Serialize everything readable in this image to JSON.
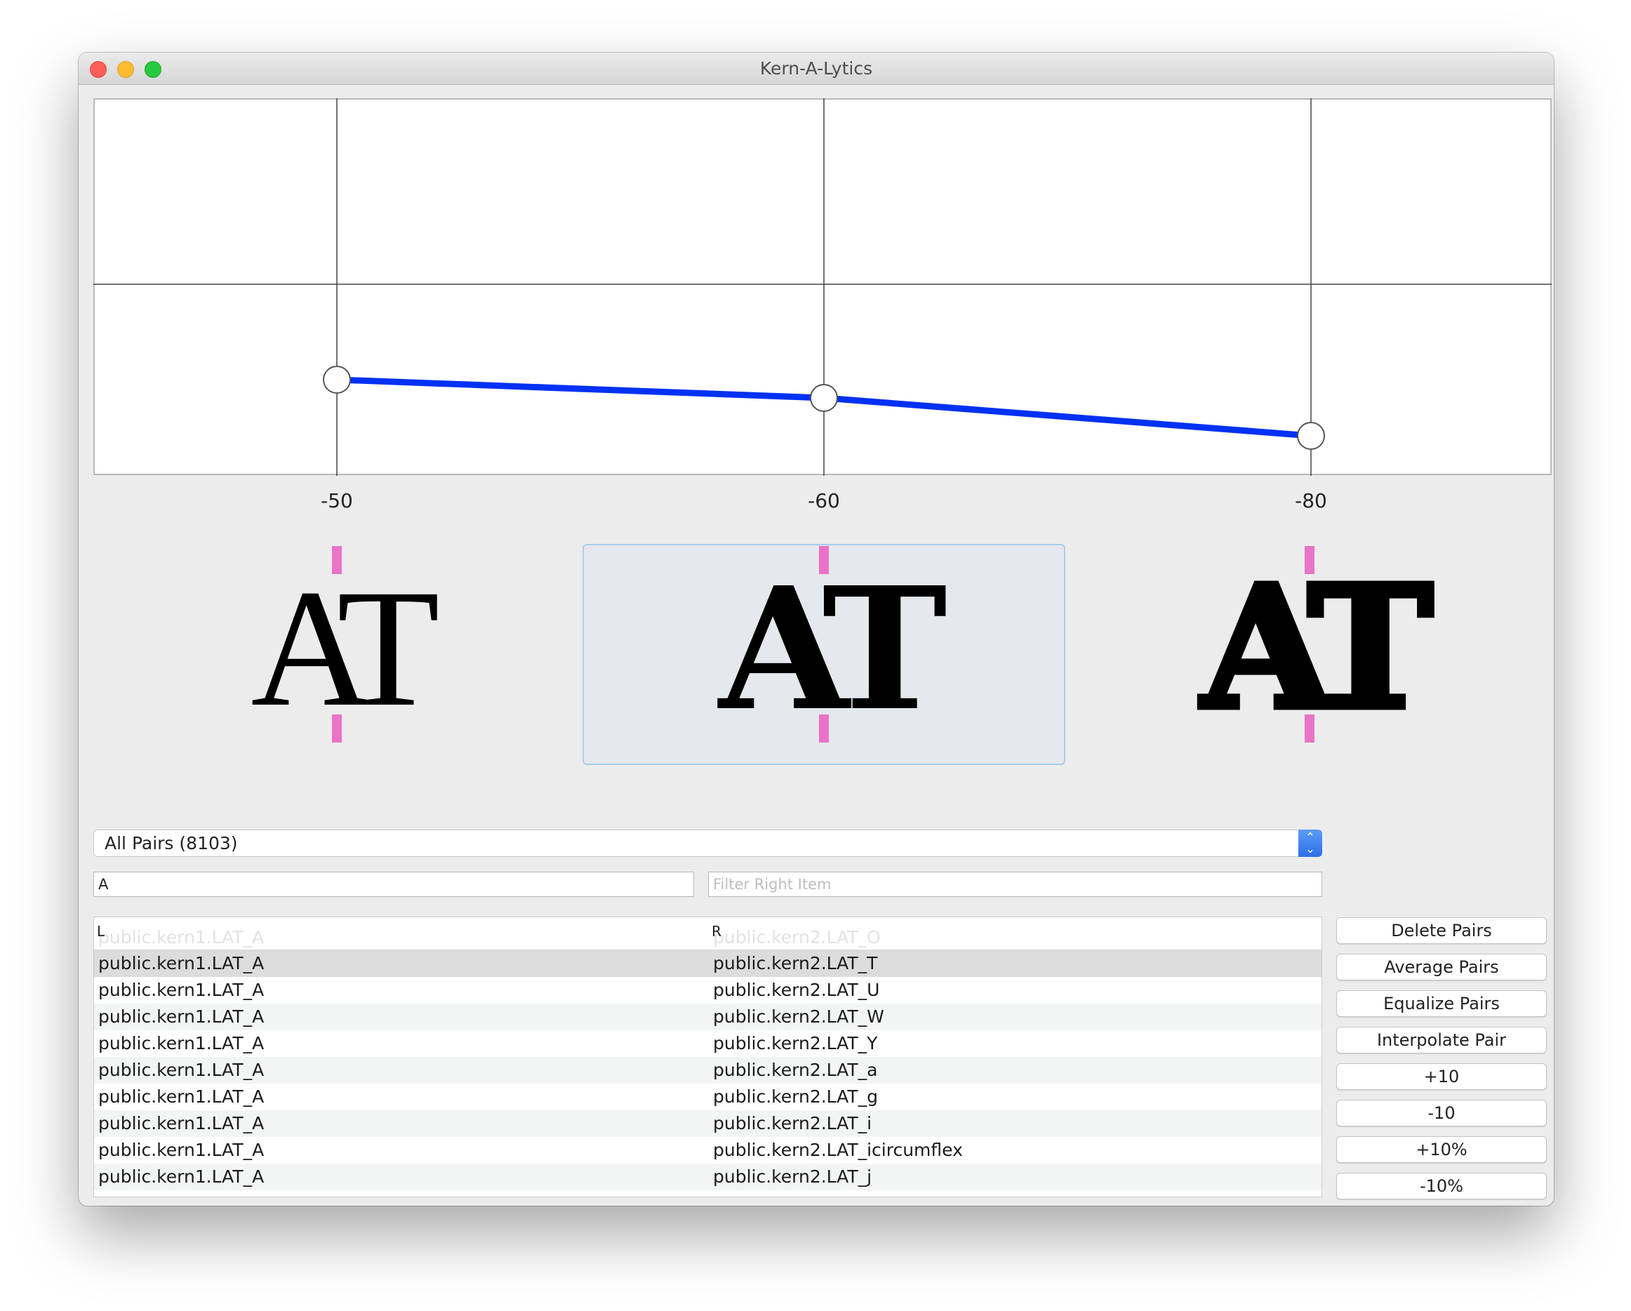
{
  "window": {
    "title": "Kern-A-Lytics"
  },
  "graph": {
    "kern_values": [
      "-50",
      "-60",
      "-80"
    ],
    "line_color": "#0031f5",
    "marker_color": "#ea73c8"
  },
  "previews": [
    {
      "text": "AT",
      "weight": "light"
    },
    {
      "text": "AT",
      "weight": "bold",
      "selected": true
    },
    {
      "text": "AT",
      "weight": "black"
    }
  ],
  "pair_selector": {
    "selected": "All Pairs (8103)"
  },
  "filters": {
    "left_value": "A",
    "left_placeholder": "",
    "right_value": "",
    "right_placeholder": "Filter Right Item"
  },
  "table": {
    "columns": {
      "left": "L",
      "right": "R"
    },
    "scrolled_row": {
      "left": "public.kern1.LAT_A",
      "right": "public.kern2.LAT_O"
    },
    "rows": [
      {
        "left": "public.kern1.LAT_A",
        "right": "public.kern2.LAT_T"
      },
      {
        "left": "public.kern1.LAT_A",
        "right": "public.kern2.LAT_U"
      },
      {
        "left": "public.kern1.LAT_A",
        "right": "public.kern2.LAT_W"
      },
      {
        "left": "public.kern1.LAT_A",
        "right": "public.kern2.LAT_Y"
      },
      {
        "left": "public.kern1.LAT_A",
        "right": "public.kern2.LAT_a"
      },
      {
        "left": "public.kern1.LAT_A",
        "right": "public.kern2.LAT_g"
      },
      {
        "left": "public.kern1.LAT_A",
        "right": "public.kern2.LAT_i"
      },
      {
        "left": "public.kern1.LAT_A",
        "right": "public.kern2.LAT_icircumflex"
      },
      {
        "left": "public.kern1.LAT_A",
        "right": "public.kern2.LAT_j"
      }
    ]
  },
  "actions": {
    "delete": "Delete Pairs",
    "average": "Average Pairs",
    "equalize": "Equalize Pairs",
    "interpolate": "Interpolate Pair",
    "plus10": "+10",
    "minus10": "-10",
    "plus10pct": "+10%",
    "minus10pct": "-10%"
  }
}
